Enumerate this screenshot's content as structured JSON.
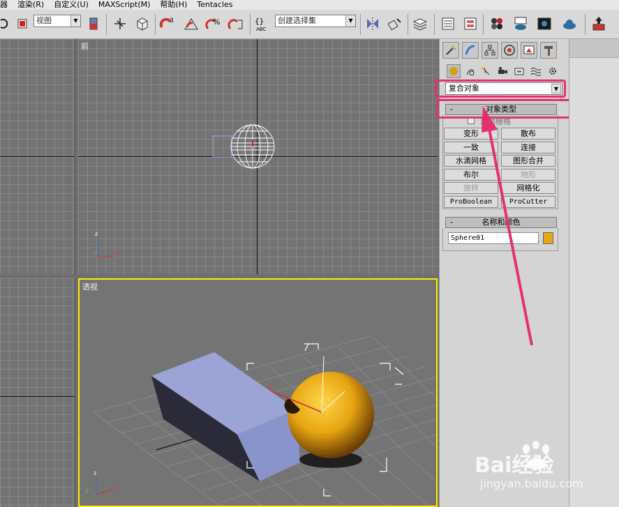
{
  "menu": [
    "器",
    "渲染(R)",
    "自定义(U)",
    "MAXScript(M)",
    "帮助(H)",
    "Tentacles"
  ],
  "toolbar": {
    "view_combo": "视图",
    "selection_set_combo": "创建选择集"
  },
  "viewports": {
    "front_label": "前",
    "perspective_label": "透视",
    "axis_x": "x",
    "axis_y": "y",
    "axis_z": "z"
  },
  "command_panel": {
    "category_dropdown": "复合对象",
    "object_type": {
      "title": "对象类型",
      "collapse": "-",
      "autogrid_label": "自动栅格",
      "buttons": [
        {
          "label": "变形",
          "enabled": true
        },
        {
          "label": "散布",
          "enabled": true
        },
        {
          "label": "一致",
          "enabled": true
        },
        {
          "label": "连接",
          "enabled": true
        },
        {
          "label": "水滴网格",
          "enabled": true
        },
        {
          "label": "图形合并",
          "enabled": true
        },
        {
          "label": "布尔",
          "enabled": true
        },
        {
          "label": "地形",
          "enabled": false
        },
        {
          "label": "放样",
          "enabled": false
        },
        {
          "label": "网格化",
          "enabled": true
        },
        {
          "label": "ProBoolean",
          "enabled": true
        },
        {
          "label": "ProCutter",
          "enabled": true
        }
      ]
    },
    "name_color": {
      "title": "名称和颜色",
      "collapse": "-",
      "name_value": "Sphere01",
      "color": "#e8a514"
    }
  },
  "colors": {
    "highlight": "#e4316f",
    "active_viewport_border": "#ffee00",
    "box": "#8f99cf",
    "sphere": "#e7a511"
  },
  "watermark": {
    "brand": "Bai经验",
    "url": "jingyan.baidu.com"
  }
}
